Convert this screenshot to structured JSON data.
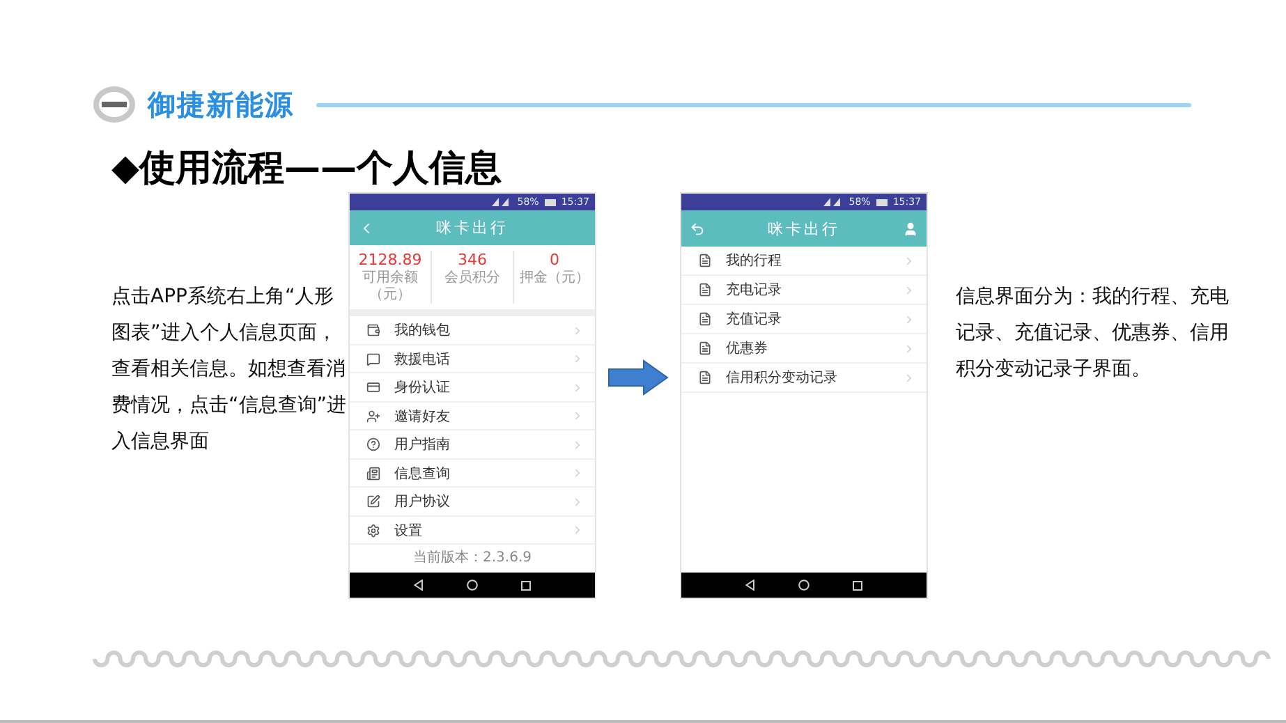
{
  "header": {
    "brand": "御捷新能源"
  },
  "title": "◆使用流程——个人信息",
  "left_text": "点击APP系统右上角“人形图表”进入个人信息页面，查看相关信息。如想查看消费情况，点击“信息查询”进入信息界面",
  "phones": [
    {
      "status": {
        "battery": "58%",
        "time": "15:37"
      },
      "title": "咪卡出行",
      "stats": [
        {
          "value": "2128.89",
          "label": "可用余额（元）"
        },
        {
          "value": "346",
          "label": "会员积分"
        },
        {
          "value": "0",
          "label": "押金（元）"
        }
      ],
      "menu": [
        {
          "label": "我的钱包"
        },
        {
          "label": "救援电话"
        },
        {
          "label": "身份认证"
        },
        {
          "label": "邀请好友"
        },
        {
          "label": "用户指南"
        },
        {
          "label": "信息查询"
        },
        {
          "label": "用户协议"
        },
        {
          "label": "设置"
        }
      ],
      "version": "当前版本：2.3.6.9"
    },
    {
      "status": {
        "battery": "58%",
        "time": "15:37"
      },
      "title": "咪卡出行",
      "menu": [
        {
          "label": "我的行程"
        },
        {
          "label": "充电记录"
        },
        {
          "label": "充值记录"
        },
        {
          "label": "优惠券"
        },
        {
          "label": "信用积分变动记录"
        }
      ]
    }
  ],
  "right_text": "信息界面分为：我的行程、充电记录、充值记录、优惠券、信用积分变动记录子界面。"
}
